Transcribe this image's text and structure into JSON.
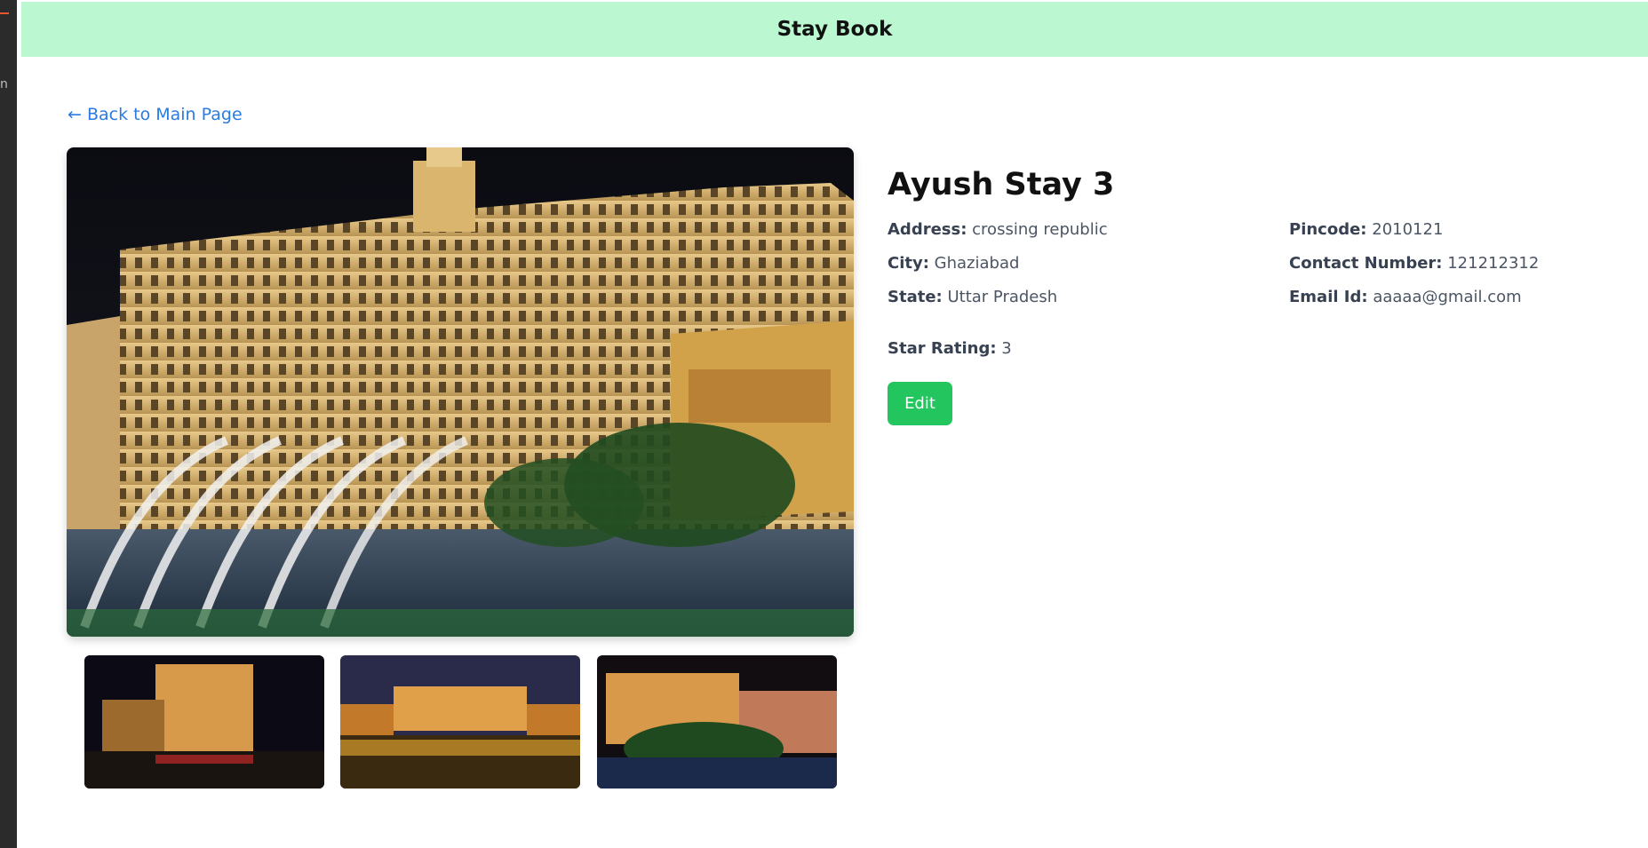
{
  "app": {
    "brand": "Stay Book"
  },
  "nav": {
    "back_link": "← Back to Main Page"
  },
  "stay": {
    "name": "Ayush Stay 3",
    "address_label": "Address:",
    "address": "crossing republic",
    "city_label": "City:",
    "city": "Ghaziabad",
    "state_label": "State:",
    "state": "Uttar Pradesh",
    "pincode_label": "Pincode:",
    "pincode": "2010121",
    "contact_label": "Contact Number:",
    "contact": "121212312",
    "email_label": "Email Id:",
    "email": "aaaaa@gmail.com",
    "rating_label": "Star Rating:",
    "rating": "3"
  },
  "actions": {
    "edit_label": "Edit"
  },
  "colors": {
    "header_bg": "#bbf7d0",
    "link": "#2b7be0",
    "edit_button": "#22c55e"
  },
  "images": {
    "main": "hotel-photo-main",
    "thumbnails": [
      "hotel-photo-thumb-1",
      "hotel-photo-thumb-2",
      "hotel-photo-thumb-3"
    ]
  }
}
